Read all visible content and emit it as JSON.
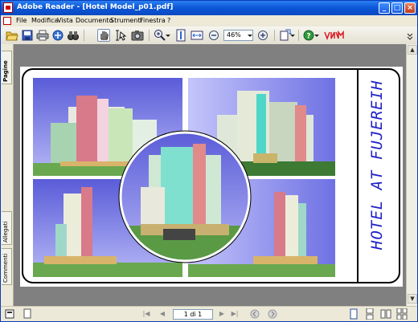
{
  "window": {
    "title": "Adobe Reader - [Hotel Model_p01.pdf]",
    "min_glyph": "_",
    "max_glyph": "□",
    "close_glyph": "×"
  },
  "menu": [
    "File",
    "Modifica",
    "Vista",
    "Documento",
    "Strumenti",
    "Finestra",
    "?"
  ],
  "toolbar": {
    "zoom_value": "46%"
  },
  "side_tabs": {
    "pages": "Pagine",
    "attachments": "Allegati",
    "comments": "Commenti"
  },
  "document": {
    "title_text": "HOTEL AT FUJEREIH"
  },
  "status": {
    "page_indicator": "1 di 1"
  },
  "colors": {
    "titlebar": "#0b56d8",
    "sky": "#7d7ff0",
    "doc_title": "#2020c8"
  }
}
